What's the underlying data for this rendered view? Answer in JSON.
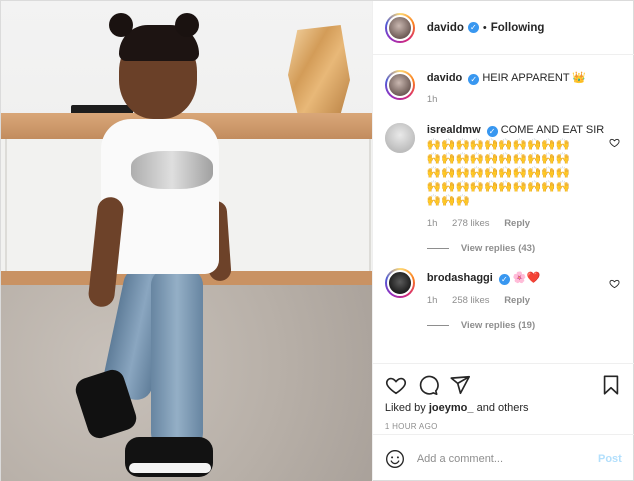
{
  "post": {
    "author": "davido",
    "follow_dot": "•",
    "follow_state": "Following",
    "caption_text": "HEIR APPARENT",
    "caption_emoji": "👑",
    "caption_time": "1h"
  },
  "comments": [
    {
      "user": "isrealdmw",
      "text": "COME AND EAT SIR",
      "emoji_rows": [
        "🙌🙌🙌🙌🙌🙌🙌🙌🙌🙌",
        "🙌🙌🙌🙌🙌🙌🙌🙌🙌🙌",
        "🙌🙌🙌🙌🙌🙌🙌🙌🙌🙌",
        "🙌🙌🙌🙌🙌🙌🙌🙌🙌🙌",
        "🙌🙌🙌"
      ],
      "time": "1h",
      "likes": "278 likes",
      "reply": "Reply",
      "view_replies": "View replies (43)"
    },
    {
      "user": "brodashaggi",
      "text": "🌸❤️",
      "time": "1h",
      "likes": "258 likes",
      "reply": "Reply",
      "view_replies": "View replies (19)"
    }
  ],
  "actions": {
    "liked_by_prefix": "Liked by",
    "liked_by_user": "joeymo_",
    "liked_by_suffix": "and others",
    "posted_ago": "1 HOUR AGO"
  },
  "add_comment": {
    "placeholder": "Add a comment...",
    "post_label": "Post"
  },
  "icons": [
    "heart-icon",
    "comment-icon",
    "share-icon",
    "bookmark-icon",
    "smiley-icon",
    "verified-icon"
  ],
  "colors": {
    "verified": "#3897f0",
    "muted": "#8e8e8e",
    "post_button_disabled": "#b2dffc",
    "heart_red": "#ed4956"
  }
}
